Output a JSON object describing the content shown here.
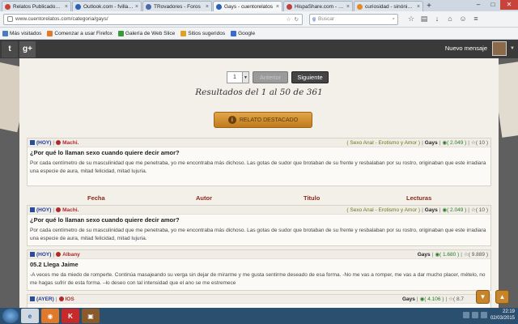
{
  "browser": {
    "tabs": [
      {
        "label": "Relatos Publicados - ...",
        "color": "#c8433a"
      },
      {
        "label": "Outlook.com - fvillar...",
        "color": "#2a62b8"
      },
      {
        "label": "TRovadores - Foros",
        "color": "#4a6aa8"
      },
      {
        "label": "Gays - cuentorelatos",
        "color": "#2a62b8"
      },
      {
        "label": "HispaShare.com - El ...",
        "color": "#c04040"
      },
      {
        "label": "curiosidad - sinónim...",
        "color": "#e08a2a"
      }
    ],
    "active_tab_index": 3,
    "url": "www.cuentorelatos.com/categoria/gays/",
    "search_placeholder": "Buscar",
    "search_engine": "g"
  },
  "bookmarks": [
    {
      "label": "Más visitados",
      "color": "#4a7ac0"
    },
    {
      "label": "Comenzar a usar Firefox",
      "color": "#e07a2a"
    },
    {
      "label": "Galería de Web Slice",
      "color": "#3a9a3a"
    },
    {
      "label": "Sitios sugeridos",
      "color": "#e0a020"
    },
    {
      "label": "Google",
      "color": "#3a6ad0"
    }
  ],
  "site": {
    "twitter_label": "t",
    "gplus_label": "g+",
    "nuevo_mensaje": "Nuevo mensaje"
  },
  "pager": {
    "page_value": "1",
    "prev_label": "Anterior",
    "next_label": "Siguiente"
  },
  "results": {
    "text": "Resultados del 1 al 50 de 361"
  },
  "featured": {
    "badge_label": "RELATO DESTACADO",
    "badge_icon": "i"
  },
  "columns": [
    "Fecha",
    "Autor",
    "Titulo",
    "Lecturas"
  ],
  "stories": [
    {
      "date": "(HOY)",
      "author": "Machi.",
      "category": "( Sexo Anal - Erotismo y Amor )",
      "section": "Gays",
      "views": "( 2.049 )",
      "votes": "( 10 )",
      "title": "¿Por qué lo llaman sexo cuando quiere decir amor?",
      "body": "Por cada centímetro de su masculinidad que me penetraba, yo me encontraba más dichoso. Las gotas de sudor que brotaban de su frente y resbalaban por su rostro, originaban que este irradiara una especie de aura, mitad felicidad, mitad lujuria."
    },
    {
      "date": "(HOY)",
      "author": "Machi.",
      "category": "( Sexo Anal - Erotismo y Amor )",
      "section": "Gays",
      "views": "( 2.049 )",
      "votes": "( 10 )",
      "title": "¿Por qué lo llaman sexo cuando quiere decir amor?",
      "body": "Por cada centímetro de su masculinidad que me penetraba, yo me encontraba más dichoso. Las gotas de sudor que brotaban de su frente y resbalaban por su rostro, originaban que este irradiara una especie de aura, mitad felicidad, mitad lujuria."
    },
    {
      "date": "(HOY)",
      "author": "Albany",
      "category": "",
      "section": "Gays",
      "views": "( 1.680 )",
      "votes": "( 9.889 )",
      "title": "05.2 Llega Jaime",
      "body": "-A veces me da miedo de romperte. Continúa masajeando su verga sin dejar de mirarme y me gusta sentirme deseado de esa forma. -No me vas a romper, me vas a dar mucho placer, mételo, no me hagas sufrir de esta forma. –lo deseo con tal intensidad que el ano se me estremece"
    },
    {
      "date": "(AYER)",
      "author": "IOS",
      "category": "",
      "section": "Gays",
      "views": "( 4.106 )",
      "votes": "( 8.7",
      "title": "",
      "body": ""
    }
  ],
  "taskbar": {
    "time": "22:19",
    "date": "02/03/2015"
  }
}
